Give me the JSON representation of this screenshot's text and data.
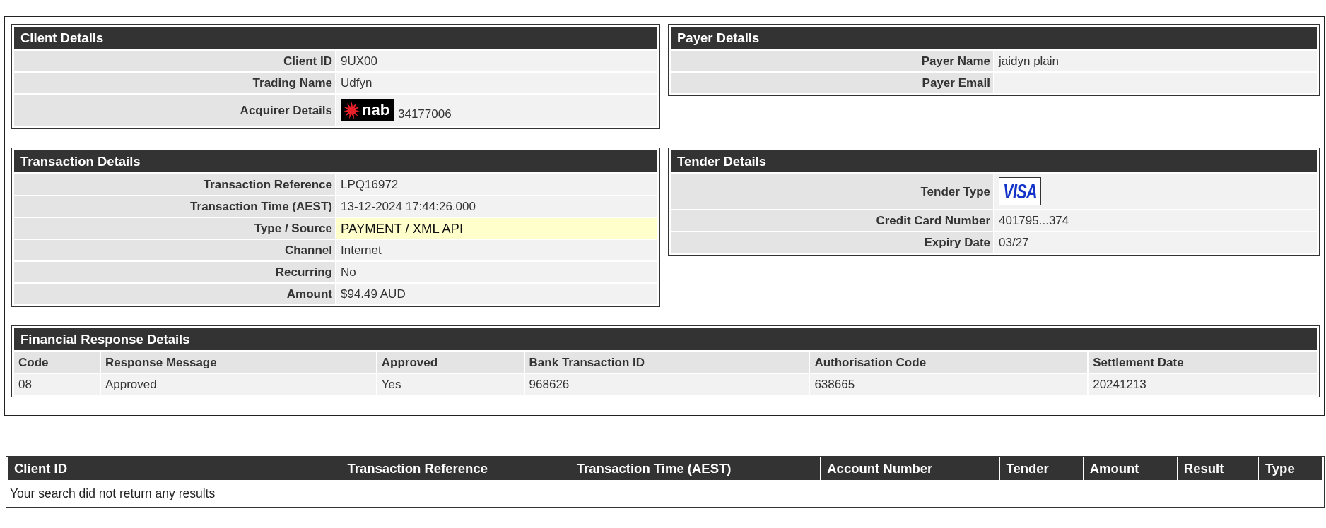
{
  "panels": [
    {
      "title": "Client Details",
      "fields": [
        {
          "kind": "text",
          "label": "Client ID",
          "value": "9UX00"
        },
        {
          "kind": "text",
          "label": "Trading Name",
          "value": "Udfyn"
        },
        {
          "kind": "banklogo",
          "label": "Acquirer Details",
          "logo": "nab",
          "value": "34177006"
        }
      ]
    },
    {
      "title": "Payer Details",
      "fields": [
        {
          "label": "Payer Name",
          "value": "jaidyn plain"
        },
        {
          "label": "Payer Email"
        }
      ]
    },
    {
      "title": "Transaction Details",
      "fields": [
        {
          "label": "Transaction Reference",
          "value": "LPQ16972",
          "highlighted": false
        },
        {
          "label": "Transaction Time (AEST)",
          "value": "13-12-2024 17:44:26.000",
          "highlighted": false
        },
        {
          "label": "Type / Source",
          "value": "PAYMENT / XML API",
          "highlighted": true
        },
        {
          "label": "Channel",
          "value": "Internet",
          "highlighted": false
        },
        {
          "label": "Recurring",
          "value": "No",
          "highlighted": false
        },
        {
          "label": "Amount",
          "value": "$94.49 AUD",
          "highlighted": false
        }
      ]
    },
    {
      "title": "Tender Details",
      "fields": [
        {
          "kind": "cardlogo",
          "label": "Tender Type",
          "logo": "VISA"
        },
        {
          "kind": "text",
          "label": "Credit Card Number",
          "value": "401795...374"
        },
        {
          "kind": "text",
          "label": "Expiry Date",
          "value": "03/27"
        }
      ]
    }
  ],
  "financial_response": {
    "title": "Financial Response Details",
    "columns": [
      "Code",
      "Response Message",
      "Approved",
      "Bank Transaction ID",
      "Authorisation Code",
      "Settlement Date"
    ],
    "rows": [
      [
        "08",
        "Approved",
        "Yes",
        "968626",
        "638665",
        "20241213"
      ]
    ]
  },
  "results_table": {
    "columns": [
      "Client ID",
      "Transaction Reference",
      "Transaction Time (AEST)",
      "Account Number",
      "Tender",
      "Amount",
      "Result",
      "Type"
    ],
    "message": "Your search did not return any results"
  }
}
